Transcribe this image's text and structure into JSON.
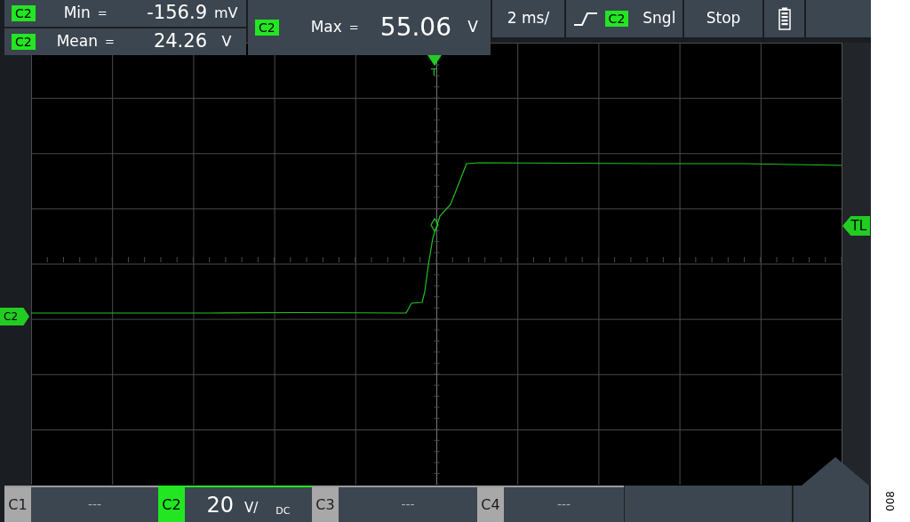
{
  "measurements": [
    {
      "channel": "C2",
      "label": "Min",
      "equals": "=",
      "value": "-156.9",
      "unit": "mV"
    },
    {
      "channel": "C2",
      "label": "Mean",
      "equals": "=",
      "value": "24.26",
      "unit": "V"
    },
    {
      "channel": "C2",
      "label": "Max",
      "equals": "=",
      "value": "55.06",
      "unit": "V"
    }
  ],
  "timebase": "2 ms/",
  "trigger": {
    "channel": "C2",
    "mode": "Sngl"
  },
  "run_button": "Stop",
  "markers": {
    "trigger_position": "T",
    "channel_offset": "C2",
    "trigger_level": "TL"
  },
  "channels": [
    {
      "label": "C1",
      "value": "---",
      "active": false
    },
    {
      "label": "C2",
      "value": "20",
      "unit": "V/",
      "coupling": "DC",
      "active": true
    },
    {
      "label": "C3",
      "value": "---",
      "active": false
    },
    {
      "label": "C4",
      "value": "---",
      "active": false
    }
  ],
  "figure_label": "008"
}
